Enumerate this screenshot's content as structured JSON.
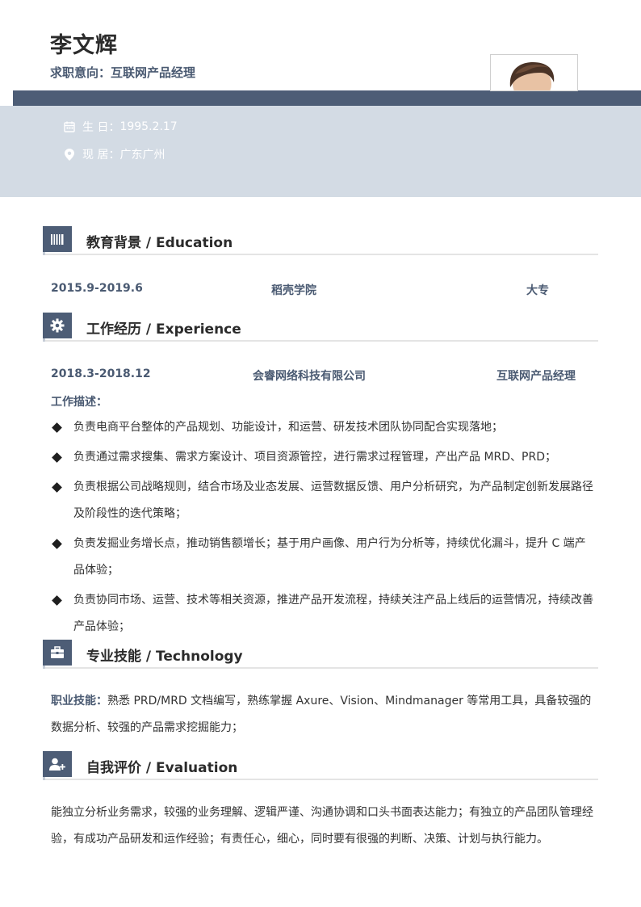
{
  "header": {
    "name": "李文辉",
    "intent_label": "求职意向：",
    "intent_value": "互联网产品经理"
  },
  "info": {
    "birth_label": "生 日：",
    "birth_value": "1995.2.17",
    "residence_label": "现 居：",
    "residence_value": "广东广州"
  },
  "sections": {
    "education": {
      "title": "教育背景 / Education",
      "date": "2015.9-2019.6",
      "school": "稻壳学院",
      "degree": "大专"
    },
    "experience": {
      "title": "工作经历 / Experience",
      "date": "2018.3-2018.12",
      "company": "会睿网络科技有限公司",
      "position": "互联网产品经理",
      "desc_label": "工作描述：",
      "items": [
        "负责电商平台整体的产品规划、功能设计，和运营、研发技术团队协同配合实现落地；",
        "负责通过需求搜集、需求方案设计、项目资源管控，进行需求过程管理，产出产品 MRD、PRD；",
        "负责根据公司战略规则，结合市场及业态发展、运营数据反馈、用户分析研究，为产品制定创新发展路径及阶段性的迭代策略；",
        "负责发掘业务增长点，推动销售额增长；基于用户画像、用户行为分析等，持续优化漏斗，提升 C 端产品体验；",
        "负责协同市场、运营、技术等相关资源，推进产品开发流程，持续关注产品上线后的运营情况，持续改善产品体验；"
      ]
    },
    "skills": {
      "title": "专业技能 / Technology",
      "label": "职业技能：",
      "text": "熟悉 PRD/MRD 文档编写，熟练掌握 Axure、Vision、Mindmanager 等常用工具，具备较强的数据分析、较强的产品需求挖掘能力；"
    },
    "evaluation": {
      "title": "自我评价 / Evaluation",
      "text": "能独立分析业务需求，较强的业务理解、逻辑严谨、沟通协调和口头书面表达能力；有独立的产品团队管理经验，有成功产品研发和运作经验；有责任心，细心，同时要有很强的判断、决策、计划与执行能力。"
    }
  },
  "colors": {
    "accent": "#4d5d76",
    "band_light": "#d3dbe4",
    "label_text": "#4a5a72"
  },
  "icons": {
    "birth": "calendar-icon",
    "residence": "map-pin-icon",
    "education": "books-icon",
    "experience": "gear-icon",
    "skills": "briefcase-icon",
    "evaluation": "user-plus-icon"
  }
}
